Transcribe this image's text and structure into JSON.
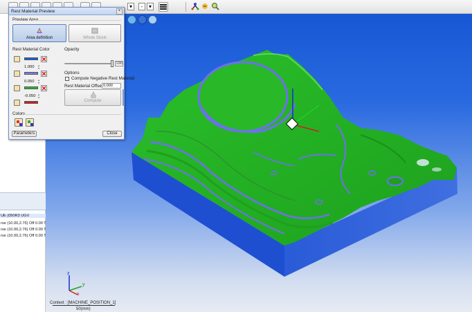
{
  "dialog": {
    "title": "Rest Material Preview",
    "preview_area_label": "Preview Area",
    "area_definition_label": "Area definition",
    "whole_stock_label": "Whole Stock",
    "rest_material_color_label": "Rest Material Color",
    "swatches": [
      {
        "color": "#1a5ce8",
        "value": null
      },
      {
        "color": "#7d7df0",
        "value": "1.000"
      },
      {
        "color": "#22c022",
        "value": "0.050"
      },
      {
        "color": "#e01818",
        "value": "-0.050"
      }
    ],
    "opacity_label": "Opacity",
    "opacity_value": "100",
    "options_label": "Options",
    "compute_negative_label": "Compute Negative Rest Material",
    "rest_material_offset_label": "Rest Material Offset:",
    "rest_material_offset_value": "0.000",
    "compute_label": "Compute",
    "colors_label": "Colors",
    "parameters_label": "Parameters",
    "close_label": "Close"
  },
  "left_panel": {
    "rows": [
      {
        "text": "UE (050R3 UGV",
        "selected": true
      },
      {
        "text": "rse (10.00,2.76) Off  0.00 T",
        "selected": false
      },
      {
        "text": "rse (10.00,2.76) Off  0.00 T",
        "selected": false
      },
      {
        "text": "rse (10.00,2.76) Off  0.00 T",
        "selected": false
      }
    ]
  },
  "viewport": {
    "context_text": "Context : [MACHINE_POSITION_1]",
    "scale_text": "50(mm)",
    "axis_x": "x",
    "axis_y": "y",
    "axis_z": "z"
  },
  "colors": {
    "model_green": "#22b322",
    "model_blue": "#1f4fd1",
    "rest_purple": "#6f6ff0",
    "background_top": "#1757d4",
    "background_bottom": "#e6ebf3"
  }
}
